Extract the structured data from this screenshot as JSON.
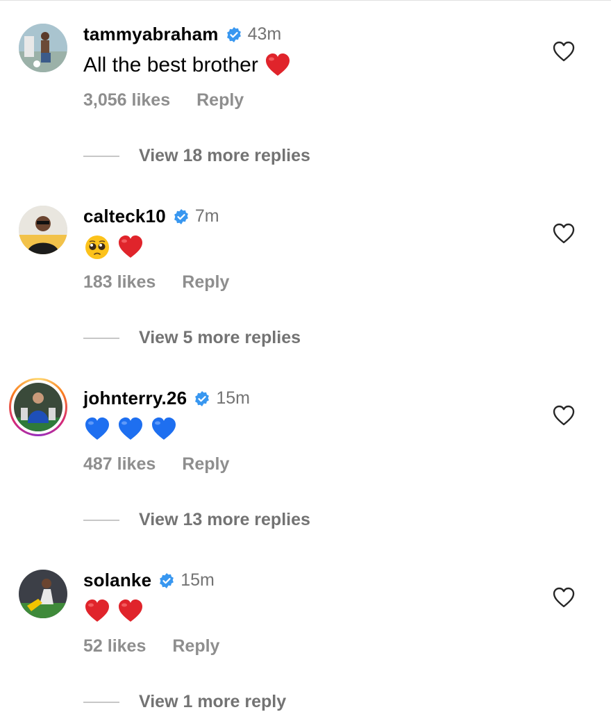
{
  "comments": [
    {
      "username": "tammyabraham",
      "time": "43m",
      "text": "All the best brother",
      "emojis": [
        "red-heart"
      ],
      "likes": "3,056 likes",
      "reply_label": "Reply",
      "view_replies": "View 18 more replies"
    },
    {
      "username": "calteck10",
      "time": "7m",
      "text": "",
      "emojis": [
        "pleading-face",
        "red-heart"
      ],
      "likes": "183 likes",
      "reply_label": "Reply",
      "view_replies": "View 5 more replies"
    },
    {
      "username": "johnterry.26",
      "time": "15m",
      "text": "",
      "emojis": [
        "blue-heart",
        "blue-heart",
        "blue-heart"
      ],
      "likes": "487 likes",
      "reply_label": "Reply",
      "view_replies": "View 13 more replies"
    },
    {
      "username": "solanke",
      "time": "15m",
      "text": "",
      "emojis": [
        "red-heart",
        "red-heart"
      ],
      "likes": "52 likes",
      "reply_label": "Reply",
      "view_replies": "View 1 more reply"
    }
  ],
  "colors": {
    "verified": "#3897f0",
    "secondary_text": "#737373",
    "meta_text": "#8e8e8e",
    "red_heart": "#e0242b",
    "blue_heart": "#1e6ff0"
  }
}
